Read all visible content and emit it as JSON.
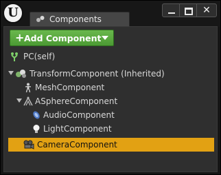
{
  "window": {
    "logo_letter": "U",
    "tab_title": "Components",
    "controls": [
      "minimize",
      "maximize",
      "close"
    ],
    "close_glyph": "✕"
  },
  "toolbar": {
    "add_component_label": "Add Component",
    "add_plus": "+"
  },
  "tree": {
    "root": {
      "label": "PC(self)",
      "icon": "pawn-icon"
    },
    "items": [
      {
        "label": "TransformComponent (Inherited)",
        "icon": "transform-component-icon",
        "expanded": true
      },
      {
        "label": "MeshComponent",
        "icon": "mesh-component-icon"
      },
      {
        "label": "ASphereComponent",
        "icon": "sphere-component-icon",
        "expanded": true
      },
      {
        "label": "AudioComponent",
        "icon": "audio-component-icon"
      },
      {
        "label": "LightComponent",
        "icon": "light-component-icon"
      },
      {
        "label": "CameraComponent",
        "icon": "camera-component-icon",
        "selected": true
      }
    ]
  },
  "colors": {
    "accent_green": "#5aab40",
    "selection": "#e2a113"
  }
}
